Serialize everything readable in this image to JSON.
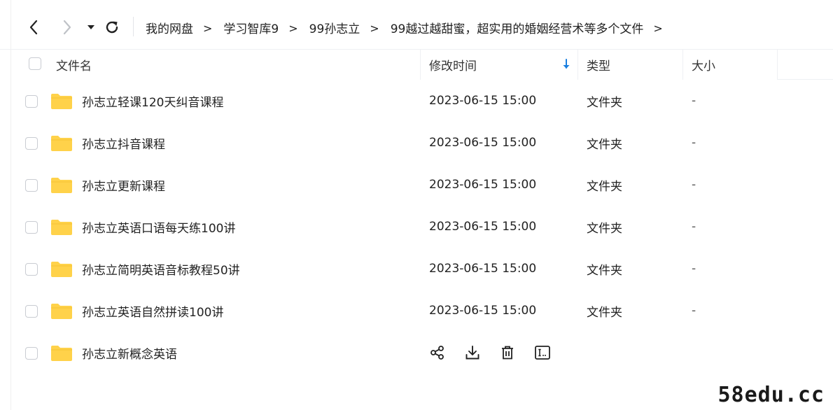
{
  "toolbar": {
    "back_icon": "chevron-left-icon",
    "forward_icon": "chevron-right-icon",
    "history_icon": "caret-down-icon",
    "refresh_icon": "refresh-icon"
  },
  "breadcrumb": {
    "items": [
      "我的网盘",
      "学习智库9",
      "99孙志立",
      "99越过越甜蜜，超实用的婚姻经营术等多个文件"
    ],
    "separator": ">"
  },
  "table": {
    "headers": {
      "name": "文件名",
      "modified": "修改时间",
      "type": "类型",
      "size": "大小"
    },
    "sort_icon": "arrow-down-icon",
    "sort_color": "#1a7fe0",
    "folder_color": "#ffd24a",
    "rows": [
      {
        "name": "孙志立轻课120天纠音课程",
        "modified": "2023-06-15 15:00",
        "type": "文件夹",
        "size": "-"
      },
      {
        "name": "孙志立抖音课程",
        "modified": "2023-06-15 15:00",
        "type": "文件夹",
        "size": "-"
      },
      {
        "name": "孙志立更新课程",
        "modified": "2023-06-15 15:00",
        "type": "文件夹",
        "size": "-"
      },
      {
        "name": "孙志立英语口语每天练100讲",
        "modified": "2023-06-15 15:00",
        "type": "文件夹",
        "size": "-"
      },
      {
        "name": "孙志立简明英语音标教程50讲",
        "modified": "2023-06-15 15:00",
        "type": "文件夹",
        "size": "-"
      },
      {
        "name": "孙志立英语自然拼读100讲",
        "modified": "2023-06-15 15:00",
        "type": "文件夹",
        "size": "-"
      }
    ],
    "hover_row": {
      "name": "孙志立新概念英语",
      "actions": [
        "share-icon",
        "download-icon",
        "delete-icon",
        "rename-icon"
      ]
    }
  },
  "watermark": "58edu.cc"
}
